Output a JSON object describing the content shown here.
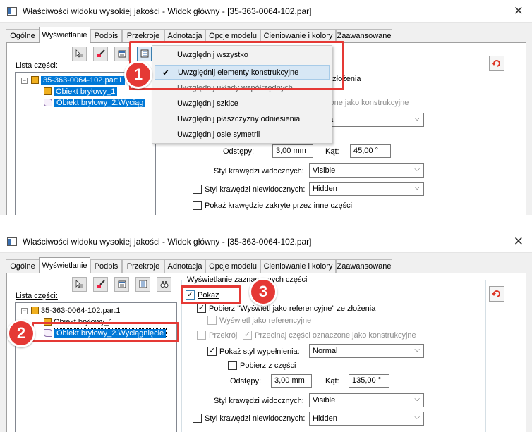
{
  "panel_top": {
    "title": "Właściwości widoku wysokiej jakości - Widok główny - [35-363-0064-102.par]",
    "close": "✕",
    "tabs": [
      "Ogólne",
      "Wyświetlanie",
      "Podpis",
      "Przekroje",
      "Adnotacja",
      "Opcje modelu",
      "Cieniowanie i kolory",
      "Zaawansowane"
    ],
    "active_tab": "Wyświetlanie",
    "parts_list_label": "Lista części:",
    "tree": [
      "35-363-0064-102.par:1",
      "Obiekt bryłowy_1",
      "Obiekt bryłowy_2.Wyciąg"
    ],
    "menu": {
      "items": [
        "Uwzględnij wszystko",
        "Uwzględnij elementy konstrukcyjne",
        "Uwzględnij układy współrzędnych",
        "Uwzględnij szkice",
        "Uwzględnij płaszczyzny odniesienia",
        "Uwzględnij osie symetrii"
      ],
      "checked_item": "Uwzględnij elementy konstrukcyjne"
    },
    "partial": {
      "zlozenia": "e złożenia",
      "konstrukcyjne": "zone jako konstrukcyjne",
      "combo_fragment": "nal"
    },
    "spacing_label": "Odstępy:",
    "spacing_value": "3,00 mm",
    "angle_label": "Kąt:",
    "angle_value": "45,00 °",
    "visible_edges_label": "Styl krawędzi widocznych:",
    "visible_edges_value": "Visible",
    "hidden_edges_label": "Styl krawędzi niewidocznych:",
    "hidden_edges_value": "Hidden",
    "show_hidden_label": "Pokaż krawędzie zakryte przez inne części",
    "badge": "1"
  },
  "panel_bottom": {
    "title": "Właściwości widoku wysokiej jakości - Widok główny - [35-363-0064-102.par]",
    "close": "✕",
    "tabs": [
      "Ogólne",
      "Wyświetlanie",
      "Podpis",
      "Przekroje",
      "Adnotacja",
      "Opcje modelu",
      "Cieniowanie i kolory",
      "Zaawansowane"
    ],
    "active_tab": "Wyświetlanie",
    "parts_list_label": "Lista części:",
    "tree": [
      "35-363-0064-102.par:1",
      "Obiekt bryłowy_1",
      "Obiekt bryłowy_2.Wyciągnięcie"
    ],
    "group_title": "Wyświetlanie zaznaczonych części",
    "show_label": "Pokaż",
    "get_ref_label": "Pobierz \"Wyświetl jako referencyjne\" ze złożenia",
    "show_ref_label": "Wyświetl jako referencyjne",
    "section_label": "Przekrój",
    "cut_label": "Przecinaj części oznaczone jako konstrukcyjne",
    "fill_label": "Pokaż styl wypełnienia:",
    "fill_value": "Normal",
    "from_part_label": "Pobierz z części",
    "spacing_label": "Odstępy:",
    "spacing_value": "3,00 mm",
    "angle_label": "Kąt:",
    "angle_value": "135,00 °",
    "visible_edges_label": "Styl krawędzi widocznych:",
    "visible_edges_value": "Visible",
    "hidden_edges_label": "Styl krawędzi niewidocznych:",
    "hidden_edges_value": "Hidden",
    "badge2": "2",
    "badge3": "3"
  },
  "colors": {
    "accent": "#e53935",
    "selection": "#0078d7",
    "menu_highlight": "#d7e7f5"
  }
}
